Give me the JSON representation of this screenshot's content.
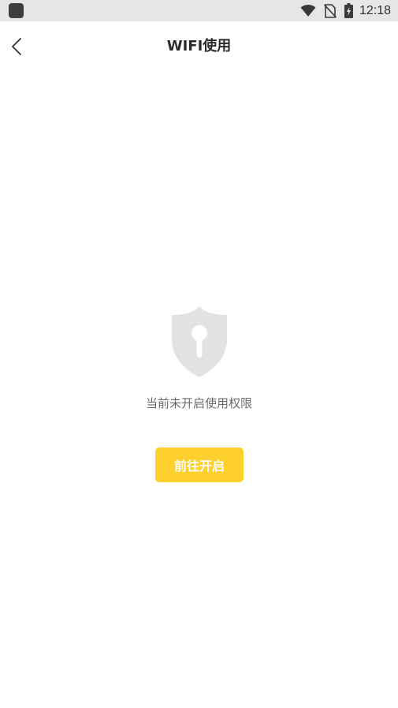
{
  "status_bar": {
    "time": "12:18",
    "icons": [
      "app-notification-icon",
      "wifi-icon",
      "no-sim-icon",
      "battery-charging-icon"
    ]
  },
  "header": {
    "back_icon": "chevron-left-icon",
    "title": "WIFI使用"
  },
  "empty_state": {
    "icon": "shield-lock-icon",
    "message": "当前未开启使用权限",
    "button_label": "前往开启"
  },
  "colors": {
    "accent": "#fdd02e",
    "status_bar_bg": "#e6e6e6",
    "icon_gray": "#e2e2e2",
    "title_text": "#2b2b2b",
    "message_text": "#6b6b6b"
  }
}
